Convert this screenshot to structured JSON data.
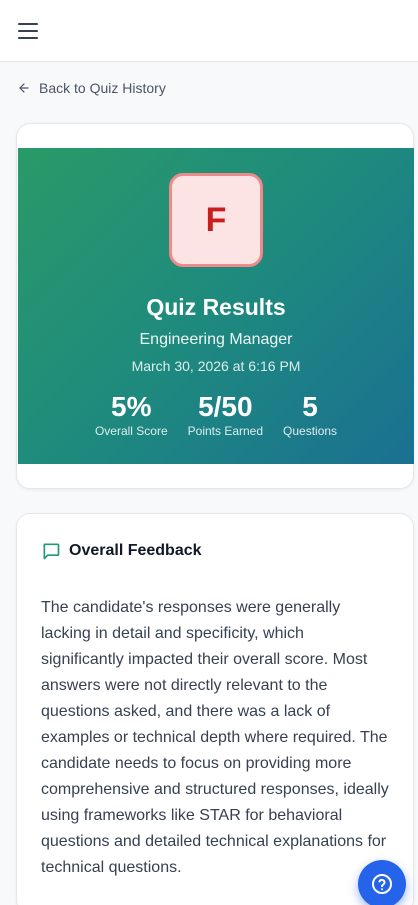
{
  "header": {
    "menu_icon": "hamburger-menu-icon"
  },
  "navigation": {
    "back_label": "Back to Quiz History",
    "back_icon": "arrow-left-icon"
  },
  "results": {
    "grade": "F",
    "title": "Quiz Results",
    "role": "Engineering Manager",
    "date": "March 30, 2026 at 6:16 PM",
    "stats": [
      {
        "value": "5%",
        "label": "Overall Score"
      },
      {
        "value": "5/50",
        "label": "Points Earned"
      },
      {
        "value": "5",
        "label": "Questions"
      }
    ],
    "colors": {
      "gradient_start": "#2a9a68",
      "gradient_end": "#1a7092",
      "grade_bg": "#fde4e4",
      "grade_text": "#c81e1e"
    }
  },
  "feedback": {
    "icon": "chat-bubble-icon",
    "title": "Overall Feedback",
    "text": "The candidate's responses were generally lacking in detail and specificity, which significantly impacted their overall score. Most answers were not directly relevant to the questions asked, and there was a lack of examples or technical depth where required. The candidate needs to focus on providing more comprehensive and structured responses, ideally using frameworks like STAR for behavioral questions and detailed technical explanations for technical questions."
  },
  "help": {
    "icon": "help-circle-icon",
    "color": "#2563eb"
  }
}
